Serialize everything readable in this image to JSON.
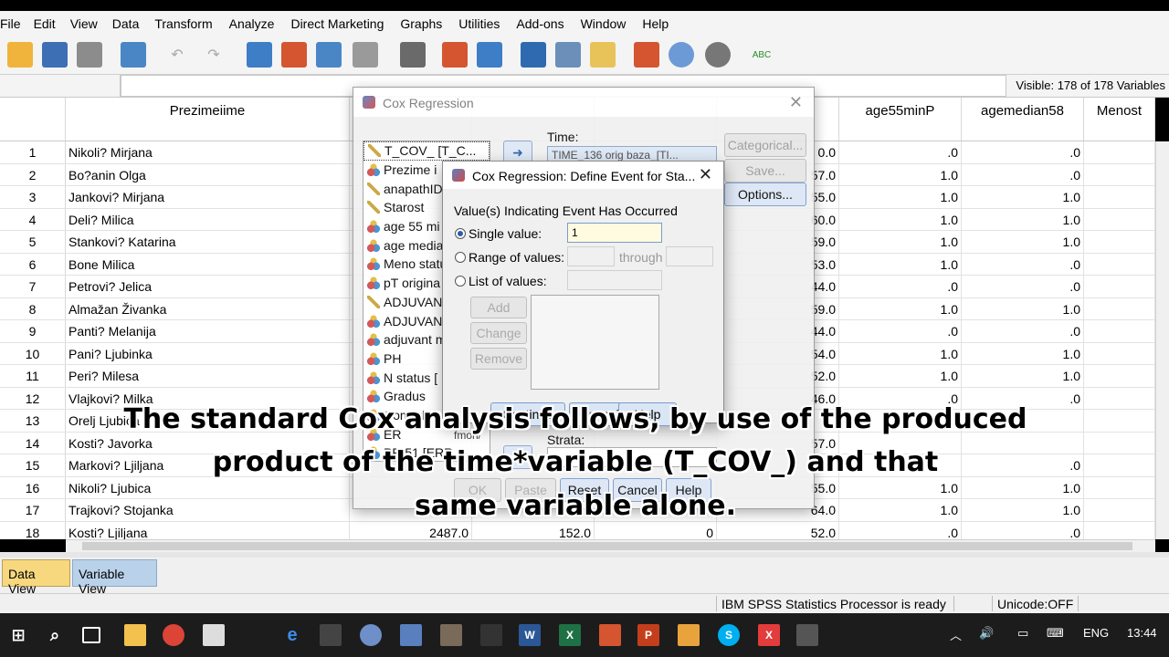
{
  "menubar": [
    "File",
    "Edit",
    "View",
    "Data",
    "Transform",
    "Analyze",
    "Direct Marketing",
    "Graphs",
    "Utilities",
    "Add-ons",
    "Window",
    "Help"
  ],
  "infobar": {
    "visible": "Visible: 178 of 178 Variables"
  },
  "columns": [
    {
      "label": "Prezimeiime"
    },
    {
      "label": ""
    },
    {
      "label": ""
    },
    {
      "label": ""
    },
    {
      "label": ""
    },
    {
      "label": "age55minP"
    },
    {
      "label": "agemedian58"
    },
    {
      "label": "Menost"
    }
  ],
  "rows": [
    {
      "n": "1",
      "name": "Nikoli? Mirjana",
      "c5": "0.0",
      "c6": ".0",
      "c7": ".0"
    },
    {
      "n": "2",
      "name": "Bo?anin Olga",
      "c5": "57.0",
      "c6": "1.0",
      "c7": ".0"
    },
    {
      "n": "3",
      "name": "Jankovi? Mirjana",
      "c5": "55.0",
      "c6": "1.0",
      "c7": "1.0"
    },
    {
      "n": "4",
      "name": "Deli? Milica",
      "c5": "60.0",
      "c6": "1.0",
      "c7": "1.0"
    },
    {
      "n": "5",
      "name": "Stankovi? Katarina",
      "c5": "59.0",
      "c6": "1.0",
      "c7": "1.0"
    },
    {
      "n": "6",
      "name": "Bone Milica",
      "c5": "53.0",
      "c6": "1.0",
      "c7": ".0"
    },
    {
      "n": "7",
      "name": "Petrovi? Jelica",
      "c5": "44.0",
      "c6": ".0",
      "c7": ".0"
    },
    {
      "n": "8",
      "name": "Almažan Živanka",
      "c5": "59.0",
      "c6": "1.0",
      "c7": "1.0"
    },
    {
      "n": "9",
      "name": "Panti? Melanija",
      "c5": "44.0",
      "c6": ".0",
      "c7": ".0"
    },
    {
      "n": "10",
      "name": "Pani? Ljubinka",
      "c5": "54.0",
      "c6": "1.0",
      "c7": "1.0"
    },
    {
      "n": "11",
      "name": "Peri? Milesa",
      "c5": "52.0",
      "c6": "1.0",
      "c7": "1.0"
    },
    {
      "n": "12",
      "name": "Vlajkovi? Milka",
      "c5": "46.0",
      "c6": ".0",
      "c7": ".0"
    },
    {
      "n": "13",
      "name": "Orelj Ljubica",
      "c5": "",
      "c6": "",
      "c7": ""
    },
    {
      "n": "14",
      "name": "Kosti? Javorka",
      "c5": "57.0",
      "c6": "",
      "c7": ""
    },
    {
      "n": "15",
      "name": "Markovi? Ljiljana",
      "c5": "",
      "c6": "",
      "c7": ".0"
    },
    {
      "n": "16",
      "name": "Nikoli? Ljubica",
      "c5": "55.0",
      "c6": "1.0",
      "c7": "1.0"
    },
    {
      "n": "17",
      "name": "Trajkovi? Stojanka",
      "c5": "64.0",
      "c6": "1.0",
      "c7": "1.0"
    },
    {
      "n": "18",
      "name": "Kosti? Ljiljana",
      "c2": "2487.0",
      "c3": "152.0",
      "c4": "0",
      "c5": "52.0",
      "c6": ".0",
      "c7": ".0"
    }
  ],
  "tabs": {
    "data_view": "Data View",
    "variable_view": "Variable View"
  },
  "status": {
    "processor": "IBM SPSS Statistics Processor is ready",
    "unicode": "Unicode:OFF"
  },
  "dialog_main": {
    "title": "Cox Regression",
    "variables": [
      {
        "label": "T_COV_ [T_C...",
        "kind": "scale"
      },
      {
        "label": "Prezime i",
        "kind": "nominal"
      },
      {
        "label": "anapathID",
        "kind": "scale"
      },
      {
        "label": "Starost",
        "kind": "scale"
      },
      {
        "label": "age 55 mi",
        "kind": "nominal"
      },
      {
        "label": "age media",
        "kind": "nominal"
      },
      {
        "label": "Meno statu",
        "kind": "nominal"
      },
      {
        "label": "pT  origina",
        "kind": "nominal"
      },
      {
        "label": "ADJUVANT",
        "kind": "scale"
      },
      {
        "label": "ADJUVANT",
        "kind": "nominal"
      },
      {
        "label": "adjuvant m",
        "kind": "nominal"
      },
      {
        "label": "PH",
        "kind": "nominal"
      },
      {
        "label": "N  status [",
        "kind": "nominal"
      },
      {
        "label": "Gradus",
        "kind": "nominal"
      },
      {
        "label": "Comorb",
        "kind": "nominal"
      },
      {
        "label": "ER",
        "kind": "nominal"
      },
      {
        "label": "PR 51 [ERR",
        "kind": "nominal"
      }
    ],
    "time_label": "Time:",
    "time_value": "TIME_136 orig baza_[TI...",
    "strata_label": "Strata:",
    "side_buttons": [
      "Categorical...",
      "Save...",
      "Options..."
    ],
    "bottom_buttons": [
      "OK",
      "Paste",
      "Reset",
      "Cancel",
      "Help"
    ],
    "fmon_fragment": "fmon/"
  },
  "dialog_event": {
    "title": "Cox Regression: Define Event for Sta...",
    "group_label": "Value(s) Indicating Event Has Occurred",
    "single_value_label": "Single value:",
    "single_value": "1",
    "range_label": "Range of values:",
    "through_label": "through",
    "list_label": "List of values:",
    "add": "Add",
    "change": "Change",
    "remove": "Remove",
    "continue": "Continue",
    "cancel": "Cancel",
    "help": "Help"
  },
  "caption": {
    "line1": "The standard Cox analysis follows, by use of the  produced",
    "line2": "product of the time*variable (T_COV_)   and that",
    "line3": "same variable alone."
  },
  "taskbar": {
    "lang": "ENG",
    "time": "13:44"
  }
}
